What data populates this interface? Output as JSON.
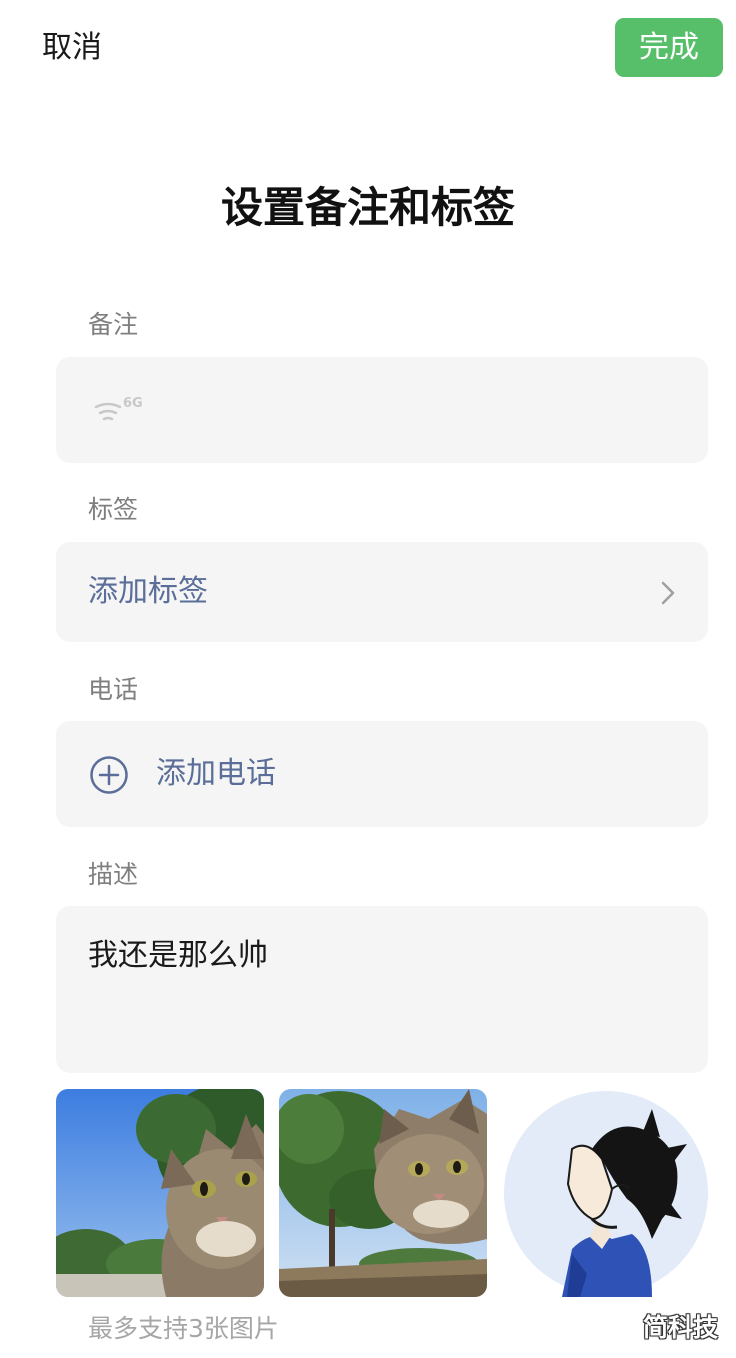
{
  "header": {
    "cancel_label": "取消",
    "done_label": "完成",
    "done_color": "#57be6a"
  },
  "title": "设置备注和标签",
  "remark": {
    "label": "备注",
    "icon": "signal-6g-icon",
    "icon_text": "6G"
  },
  "tags": {
    "label": "标签",
    "add_label": "添加标签",
    "icon": "chevron-right-icon"
  },
  "phone": {
    "label": "电话",
    "add_label": "添加电话",
    "icon": "plus-circle-icon"
  },
  "description": {
    "label": "描述",
    "value": "我还是那么帅"
  },
  "photos": {
    "items": [
      "cat-photo-1",
      "cat-photo-2",
      "anime-avatar"
    ],
    "hint": "最多支持3张图片"
  },
  "watermark": "简科技",
  "colors": {
    "link": "#5a6e99",
    "field_bg": "#f5f5f5",
    "label": "#7f7f7f"
  }
}
